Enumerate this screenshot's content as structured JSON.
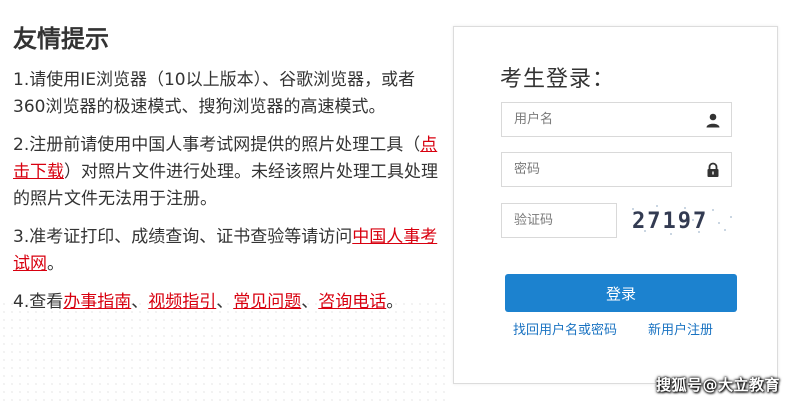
{
  "notice": {
    "title": "友情提示",
    "item1": "1.请使用IE浏览器（10以上版本）、谷歌浏览器，或者360浏览器的极速模式、搜狗浏览器的高速模式。",
    "item2_a": "2.注册前请使用中国人事考试网提供的照片处理工具（",
    "item2_link": "点击下载",
    "item2_b": "）对照片文件进行处理。未经该照片处理工具处理的照片文件无法用于注册。",
    "item3_a": "3.准考证打印、成绩查询、证书查验等请访问",
    "item3_link": "中国人事考试网",
    "item3_b": "。",
    "item4_prefix": "4.查看",
    "item4_links": [
      "办事指南",
      "视频指引",
      "常见问题",
      "咨询电话"
    ],
    "item4_sep": "、",
    "item4_suffix": "。"
  },
  "login": {
    "title": "考生登录：",
    "username_placeholder": "用户名",
    "password_placeholder": "密码",
    "captcha_placeholder": "验证码",
    "captcha_text": "27197",
    "submit_label": "登录",
    "forgot_link": "找回用户名或密码",
    "register_link": "新用户注册"
  },
  "watermark": "搜狐号@大立教育",
  "colors": {
    "link_red": "#d8000f",
    "button_blue": "#1c82cf",
    "link_blue": "#1a73c2"
  },
  "icons": {
    "username": "user-icon",
    "password": "lock-icon"
  }
}
